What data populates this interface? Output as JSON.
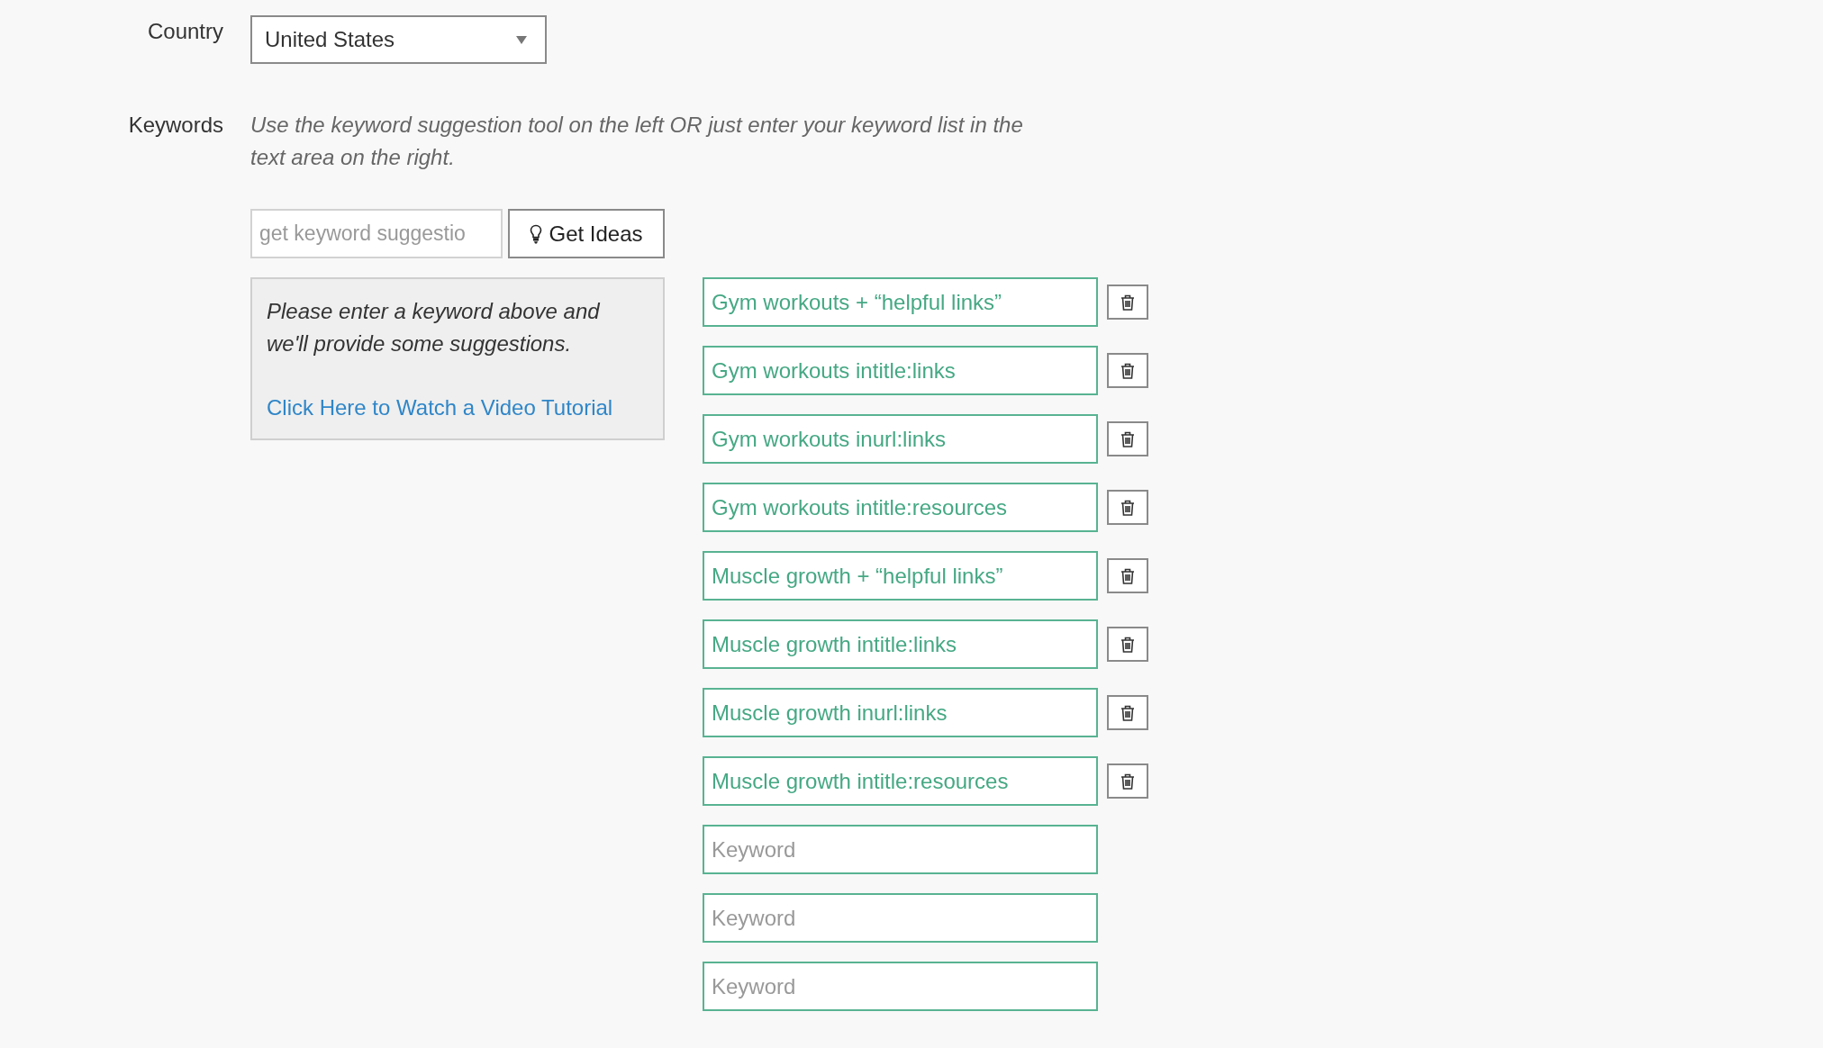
{
  "country": {
    "label": "Country",
    "value": "United States"
  },
  "keywords": {
    "label": "Keywords",
    "instructions": "Use the keyword suggestion tool on the left OR just enter your keyword list in the text area on the right.",
    "suggestion_field": {
      "placeholder": "get keyword suggestio"
    },
    "get_ideas_button": {
      "label": "Get Ideas"
    },
    "suggestion_panel": {
      "message": "Please enter a keyword above and we'll provide some suggestions.",
      "link": "Click Here to Watch a Video Tutorial"
    },
    "keyword_list": [
      {
        "kind": "filled",
        "value": "Gym workouts + “helpful links”"
      },
      {
        "kind": "filled",
        "value": "Gym workouts intitle:links"
      },
      {
        "kind": "filled",
        "value": "Gym workouts inurl:links"
      },
      {
        "kind": "filled",
        "value": "Gym workouts intitle:resources"
      },
      {
        "kind": "filled",
        "value": "Muscle growth + “helpful links”"
      },
      {
        "kind": "filled",
        "value": "Muscle growth intitle:links"
      },
      {
        "kind": "filled",
        "value": "Muscle growth inurl:links"
      },
      {
        "kind": "filled",
        "value": "Muscle growth intitle:resources"
      },
      {
        "kind": "empty",
        "placeholder": "Keyword"
      },
      {
        "kind": "empty",
        "placeholder": "Keyword"
      },
      {
        "kind": "empty",
        "placeholder": "Keyword"
      }
    ]
  }
}
